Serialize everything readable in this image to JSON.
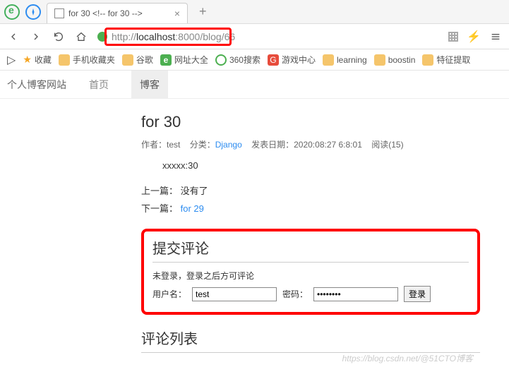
{
  "browser": {
    "tab_title": "for 30 <!-- for 30 -->",
    "url_pre": "http://",
    "url_host": "localhost",
    "url_post": ":8000/blog/66",
    "new_tab": "+"
  },
  "bookmarks": {
    "fav_label": "收藏",
    "items": [
      {
        "label": "手机收藏夹",
        "icon": "folder"
      },
      {
        "label": "谷歌",
        "icon": "folder"
      },
      {
        "label": "网址大全",
        "icon": "g360"
      },
      {
        "label": "360搜索",
        "icon": "circle"
      },
      {
        "label": "游戏中心",
        "icon": "redc"
      },
      {
        "label": "learning",
        "icon": "folder"
      },
      {
        "label": "boostin",
        "icon": "folder"
      },
      {
        "label": "特征提取",
        "icon": "folder"
      }
    ]
  },
  "site": {
    "brand": "个人博客网站",
    "nav_home": "首页",
    "nav_blog": "博客"
  },
  "post": {
    "title": "for 30",
    "author_label": "作者：",
    "author": "test",
    "cat_label": "分类：",
    "category": "Django",
    "date_label": "发表日期：",
    "date": "2020:08:27 6:8:01",
    "reads": "阅读(15)",
    "body": "xxxxx:30",
    "prev_label": "上一篇：",
    "prev_text": "没有了",
    "next_label": "下一篇：",
    "next_link": "for 29"
  },
  "comment": {
    "title": "提交评论",
    "hint": "未登录，登录之后方可评论",
    "user_label": "用户名：",
    "user_value": "test",
    "pwd_label": "密码：",
    "pwd_value": "••••••••",
    "login_btn": "登录",
    "list_title": "评论列表"
  },
  "watermark": "https://blog.csdn.net/@51CTO博客"
}
